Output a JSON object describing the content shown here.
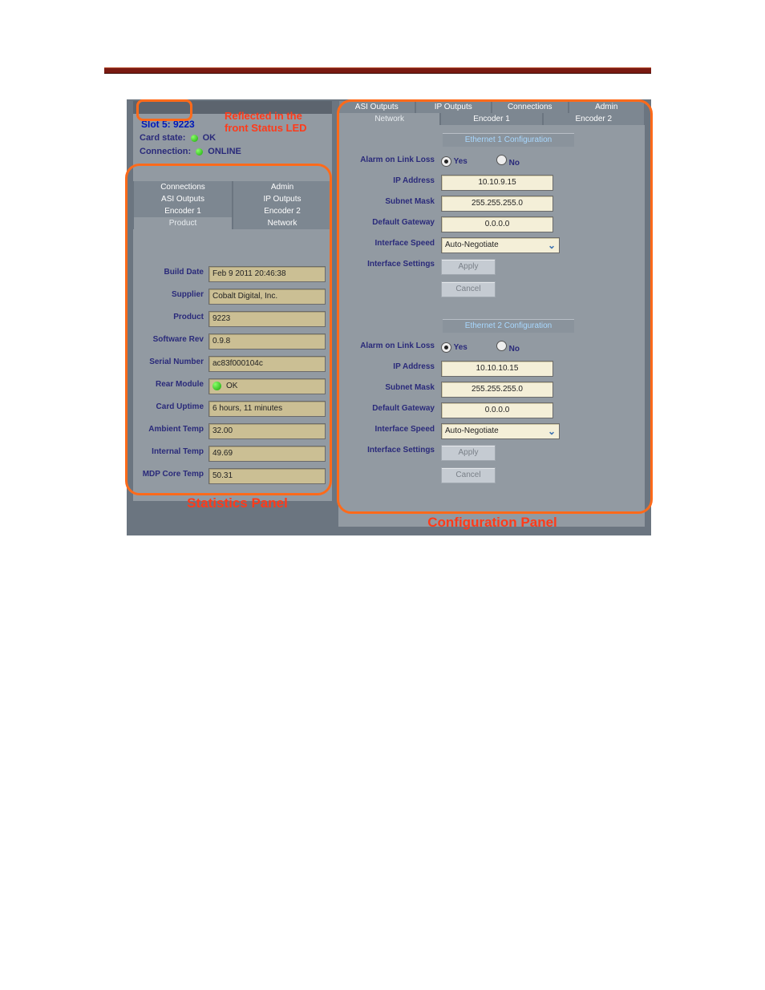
{
  "left": {
    "slot_title": "Slot 5: 9223",
    "card_state_label": "Card state:",
    "card_state_value": "OK",
    "connection_label": "Connection:",
    "connection_value": "ONLINE",
    "tabs": [
      "Connections",
      "Admin",
      "ASI Outputs",
      "IP Outputs",
      "Encoder 1",
      "Encoder 2",
      "Product",
      "Network"
    ],
    "stats": [
      {
        "label": "Build Date",
        "value": "Feb  9 2011 20:46:38"
      },
      {
        "label": "Supplier",
        "value": "Cobalt Digital, Inc."
      },
      {
        "label": "Product",
        "value": "9223"
      },
      {
        "label": "Software Rev",
        "value": "0.9.8"
      },
      {
        "label": "Serial Number",
        "value": "ac83f000104c"
      },
      {
        "label": "Rear Module",
        "value": "OK"
      },
      {
        "label": "Card Uptime",
        "value": "6 hours, 11 minutes"
      },
      {
        "label": "Ambient Temp",
        "value": "32.00"
      },
      {
        "label": "Internal Temp",
        "value": "49.69"
      },
      {
        "label": "MDP Core Temp",
        "value": "50.31"
      }
    ]
  },
  "right": {
    "tabs": [
      "ASI Outputs",
      "IP Outputs",
      "Connections",
      "Admin",
      "Network",
      "Encoder 1",
      "Encoder 2"
    ],
    "labels": {
      "alarm": "Alarm on Link Loss",
      "ip": "IP Address",
      "subnet": "Subnet Mask",
      "gateway": "Default Gateway",
      "speed": "Interface Speed",
      "settings": "Interface Settings",
      "apply": "Apply",
      "cancel": "Cancel",
      "yes": "Yes",
      "no": "No"
    },
    "eth1": {
      "title": "Ethernet 1 Configuration",
      "alarm": "Yes",
      "ip": "10.10.9.15",
      "subnet": "255.255.255.0",
      "gateway": "0.0.0.0",
      "speed": "Auto-Negotiate"
    },
    "eth2": {
      "title": "Ethernet 2 Configuration",
      "alarm": "Yes",
      "ip": "10.10.10.15",
      "subnet": "255.255.255.0",
      "gateway": "0.0.0.0",
      "speed": "Auto-Negotiate"
    }
  },
  "annotations": {
    "reflected_line1": "Reflected in the",
    "reflected_line2": "front Status LED",
    "stats_panel": "Statistics Panel",
    "config_panel": "Configuration Panel"
  }
}
